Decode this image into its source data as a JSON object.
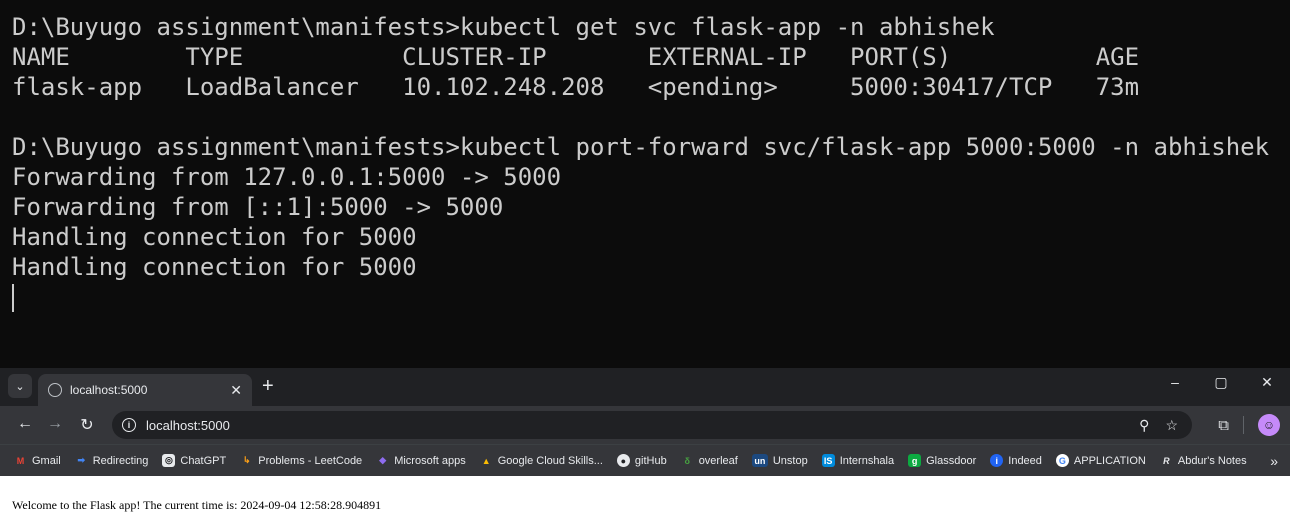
{
  "terminal": {
    "lines": [
      "D:\\Buyugo assignment\\manifests>kubectl get svc flask-app -n abhishek",
      "NAME        TYPE           CLUSTER-IP       EXTERNAL-IP   PORT(S)          AGE",
      "flask-app   LoadBalancer   10.102.248.208   <pending>     5000:30417/TCP   73m",
      "",
      "D:\\Buyugo assignment\\manifests>kubectl port-forward svc/flask-app 5000:5000 -n abhishek",
      "Forwarding from 127.0.0.1:5000 -> 5000",
      "Forwarding from [::1]:5000 -> 5000",
      "Handling connection for 5000",
      "Handling connection for 5000"
    ]
  },
  "browser": {
    "tab": {
      "title": "localhost:5000",
      "close_icon": "close-icon",
      "new_tab_label": "+"
    },
    "window_controls": {
      "minimize": "–",
      "restore": "▢",
      "close": "✕"
    },
    "toolbar": {
      "back": "←",
      "forward": "→",
      "reload": "↻",
      "url": "localhost:5000",
      "zoom": "🔍",
      "star": "☆",
      "extensions": "⧉"
    },
    "bookmarks": [
      {
        "label": "Gmail",
        "icon": "M",
        "color": "#ea4335"
      },
      {
        "label": "Redirecting",
        "icon": "➡",
        "color": "#4285f4"
      },
      {
        "label": "ChatGPT",
        "icon": "◎",
        "color": "#5f6368"
      },
      {
        "label": "Problems - LeetCode",
        "icon": "↳",
        "color": "#ffa116"
      },
      {
        "label": "Microsoft apps",
        "icon": "◆",
        "color": "#8e6cef"
      },
      {
        "label": "Google Cloud Skills...",
        "icon": "▲",
        "color": "#4285f4"
      },
      {
        "label": "gitHub",
        "icon": "●",
        "color": "#202124"
      },
      {
        "label": "overleaf",
        "icon": "δ",
        "color": "#47a141"
      },
      {
        "label": "Unstop",
        "icon": "un",
        "color": "#1c4980"
      },
      {
        "label": "Internshala",
        "icon": "IS",
        "color": "#008bdc"
      },
      {
        "label": "Glassdoor",
        "icon": "g",
        "color": "#0caa41"
      },
      {
        "label": "Indeed",
        "icon": "i",
        "color": "#2164f3"
      },
      {
        "label": "APPLICATION",
        "icon": "G",
        "color": "#4285f4"
      },
      {
        "label": "Abdur's Notes",
        "icon": "R",
        "color": "#5f6368"
      }
    ],
    "bookmarks_more": "»",
    "page_text": "Welcome to the Flask app! The current time is: 2024-09-04 12:58:28.904891"
  }
}
